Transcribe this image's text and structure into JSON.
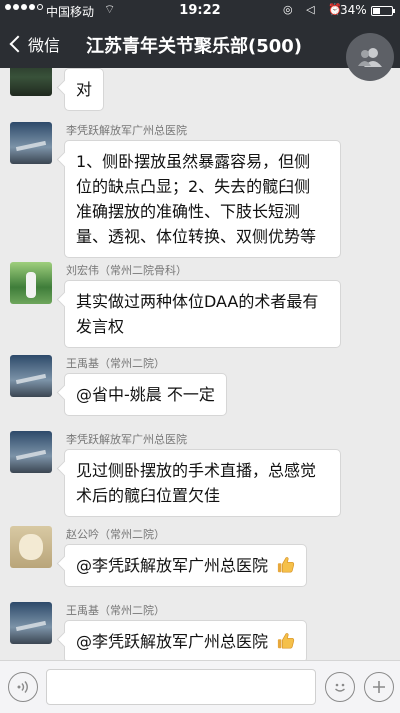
{
  "status_bar": {
    "carrier": "中国移动",
    "wifi_icon": "wifi-icon",
    "time": "19:22",
    "right_icons": "◎ ◁ ⏰",
    "battery_percent": "34%"
  },
  "nav": {
    "back_label": "微信",
    "title": "江苏青年关节聚乐部(500)",
    "group_icon": "group-members-icon"
  },
  "messages": [
    {
      "sender": "",
      "avatar": "dark",
      "text": "对"
    },
    {
      "sender": "李凭跃解放军广州总医院",
      "avatar": "sky",
      "lines": [
        "1、侧卧摆放虽然暴露容易，但侧",
        "位的缺点凸显；2、失去的髋臼侧",
        "准确摆放的准确性、下肢长短测",
        "量、透视、体位转换、双侧优势等"
      ]
    },
    {
      "sender": "刘宏伟（常州二院骨科）",
      "avatar": "green",
      "lines": [
        "其实做过两种体位DAA的术者最有",
        "发言权"
      ]
    },
    {
      "sender": "王禹基（常州二院）",
      "avatar": "sky",
      "text": "@省中-姚晨 不一定"
    },
    {
      "sender": "李凭跃解放军广州总医院",
      "avatar": "sky",
      "lines": [
        "见过侧卧摆放的手术直播，总感觉",
        "术后的髋臼位置欠佳"
      ]
    },
    {
      "sender": "赵公吟（常州二院）",
      "avatar": "dog",
      "text": "@李凭跃解放军广州总医院",
      "emoji": "thumbs-up-icon"
    },
    {
      "sender": "王禹基（常州二院）",
      "avatar": "sky",
      "text": "@李凭跃解放军广州总医院",
      "emoji": "thumbs-up-icon"
    }
  ],
  "input_bar": {
    "voice_icon": "voice-icon",
    "placeholder": "",
    "emoji_icon": "emoji-icon",
    "plus_icon": "plus-icon"
  }
}
